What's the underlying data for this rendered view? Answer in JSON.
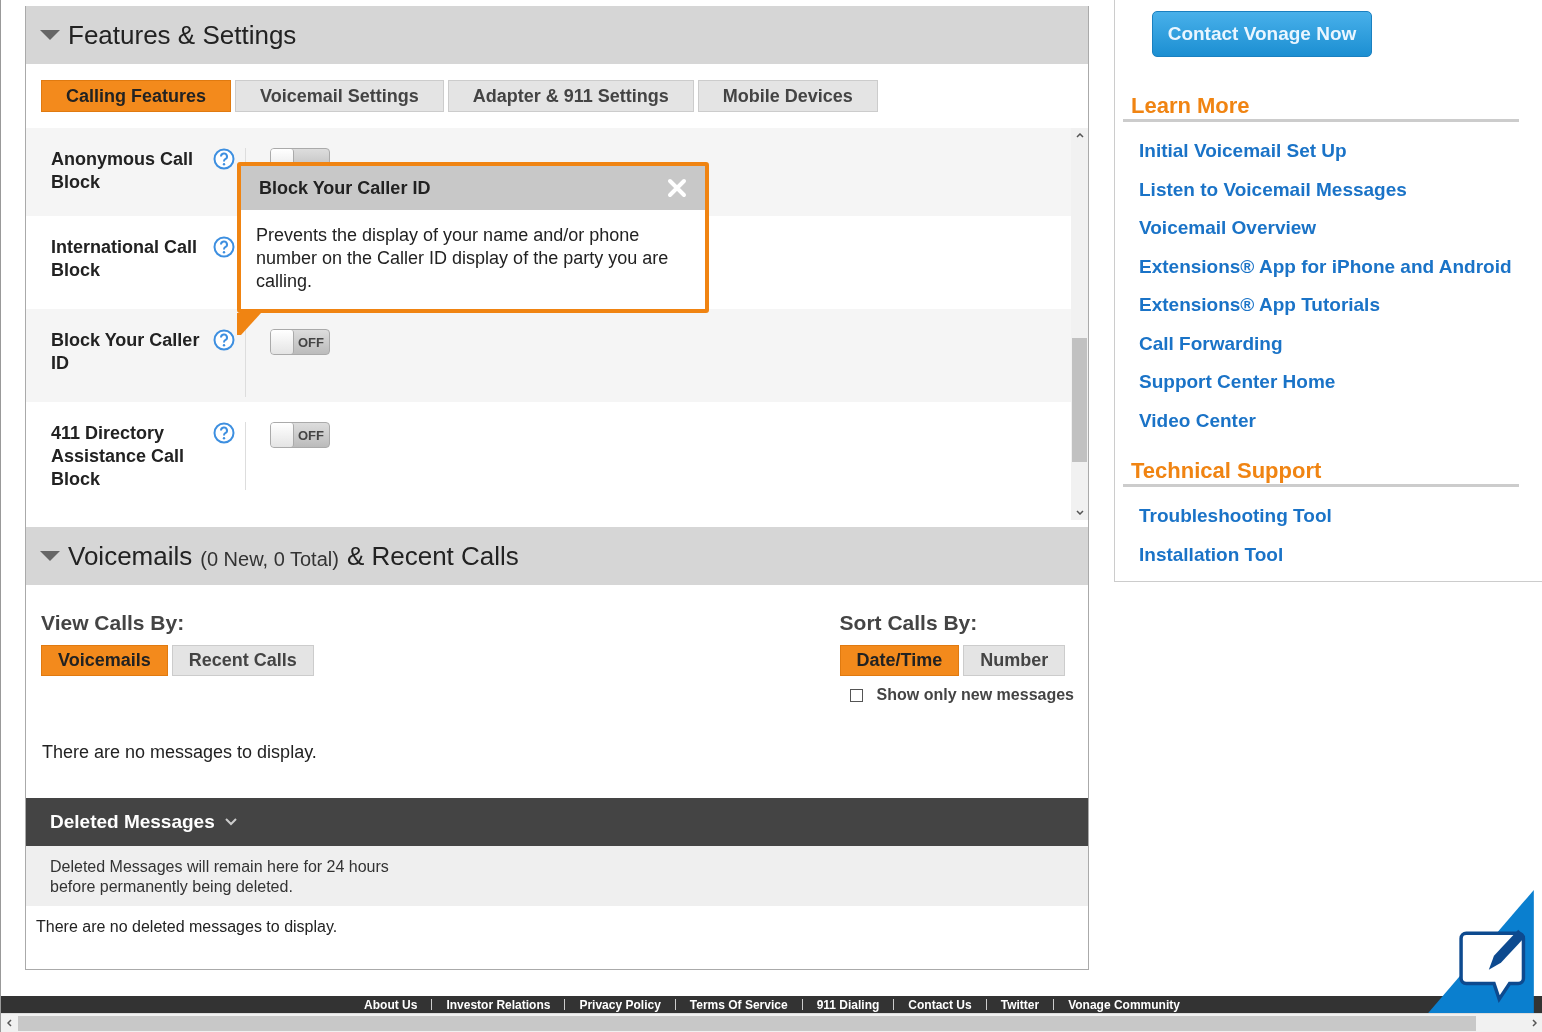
{
  "features": {
    "title": "Features & Settings",
    "expanded": true,
    "tabs": [
      {
        "label": "Calling Features",
        "selected": true
      },
      {
        "label": "Voicemail Settings",
        "selected": false
      },
      {
        "label": "Adapter & 911 Settings",
        "selected": false
      },
      {
        "label": "Mobile Devices",
        "selected": false
      }
    ],
    "settings": [
      {
        "name": "Anonymous Call Block",
        "on": false
      },
      {
        "name": "International Call Block"
      },
      {
        "name": "Block Your Caller ID",
        "on": false,
        "toggle_label": "OFF"
      },
      {
        "name": "411 Directory Assistance Call Block",
        "on": false,
        "toggle_label": "OFF"
      }
    ],
    "popup": {
      "title": "Block Your Caller ID",
      "text": "Prevents the display of your name and/or phone number on the Caller ID display of the party you are calling."
    }
  },
  "voicemails": {
    "title": "Voicemails",
    "counts": "(0 New, 0 Total)",
    "title_suffix": "& Recent Calls",
    "expanded": true,
    "view_label": "View Calls By:",
    "view_options": [
      {
        "label": "Voicemails",
        "selected": true
      },
      {
        "label": "Recent Calls",
        "selected": false
      }
    ],
    "sort_label": "Sort Calls By:",
    "sort_options": [
      {
        "label": "Date/Time",
        "selected": true
      },
      {
        "label": "Number",
        "selected": false
      }
    ],
    "new_only": {
      "label": "Show only new messages",
      "checked": false
    },
    "empty_text": "There are no messages to display."
  },
  "deleted": {
    "title": "Deleted Messages",
    "note": "Deleted Messages will remain here for 24 hours before permanently being deleted.",
    "empty_text": "There are no deleted messages to display."
  },
  "sidebar": {
    "contact_button": "Contact Vonage Now",
    "sections": [
      {
        "heading": "Learn More",
        "links": [
          "Initial Voicemail Set Up",
          "Listen to Voicemail Messages",
          "Voicemail Overview",
          "Extensions® App for iPhone and Android",
          "Extensions® App Tutorials",
          "Call Forwarding",
          "Support Center Home",
          "Video Center"
        ]
      },
      {
        "heading": "Technical Support",
        "links": [
          "Troubleshooting Tool",
          "Installation Tool"
        ]
      }
    ]
  },
  "footer_links": [
    "About Us",
    "Investor Relations",
    "Privacy Policy",
    "Terms Of Service",
    "911 Dialing",
    "Contact Us",
    "Twitter",
    "Vonage Community"
  ]
}
